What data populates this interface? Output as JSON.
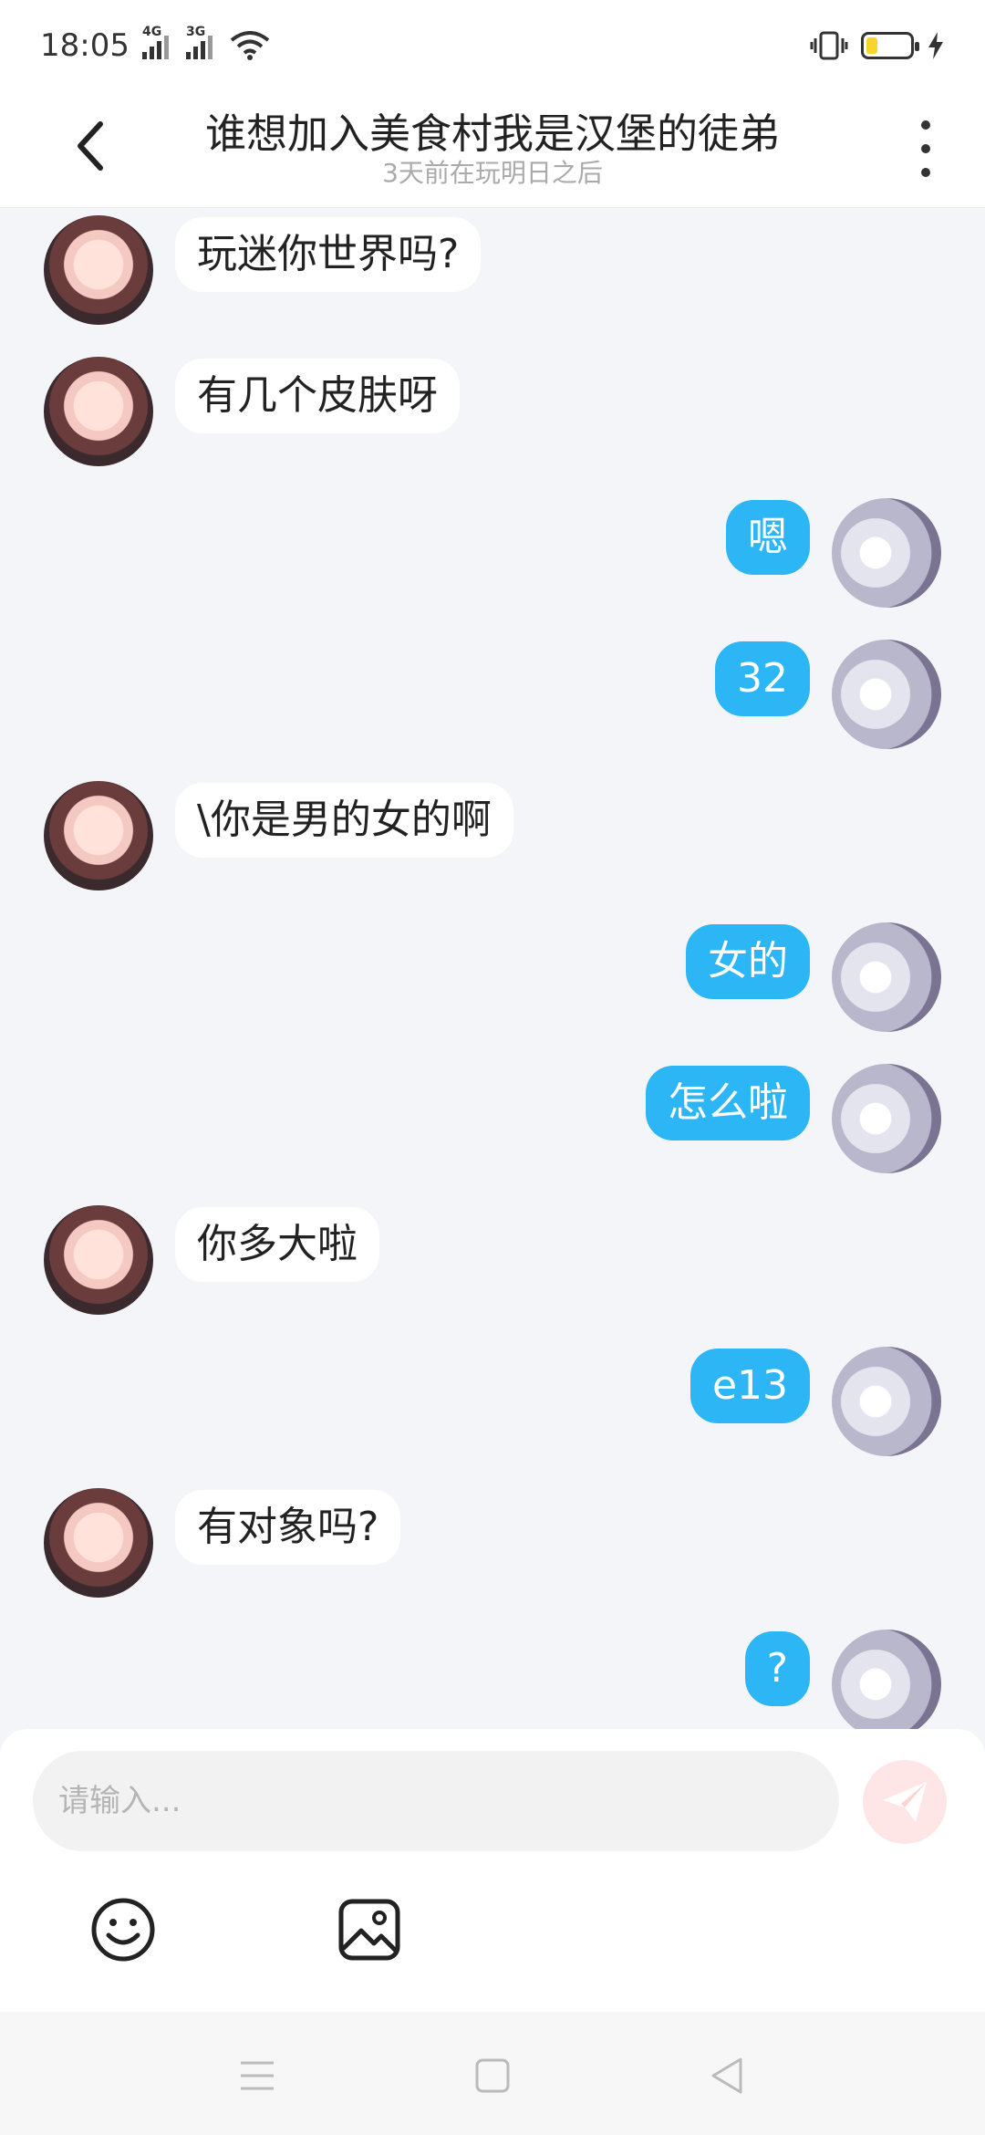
{
  "status_bar": {
    "time": "18:05",
    "network_1": "4G",
    "network_2": "3G",
    "battery_level": 0.15,
    "battery_color": "#f7d52a"
  },
  "header": {
    "title": "谁想加入美食村我是汉堡的徒弟",
    "subtitle": "3天前在玩明日之后"
  },
  "messages": [
    {
      "side": "left",
      "text": "玩迷你世界吗?"
    },
    {
      "side": "left",
      "text": "有几个皮肤呀"
    },
    {
      "side": "right",
      "text": "嗯"
    },
    {
      "side": "right",
      "text": "32"
    },
    {
      "side": "left",
      "text": "\\你是男的女的啊"
    },
    {
      "side": "right",
      "text": "女的"
    },
    {
      "side": "right",
      "text": "怎么啦"
    },
    {
      "side": "left",
      "text": "你多大啦"
    },
    {
      "side": "right",
      "text": "e13"
    },
    {
      "side": "left",
      "text": "有对象吗?"
    },
    {
      "side": "right",
      "text": "?"
    }
  ],
  "composer": {
    "placeholder": "请输入...",
    "value": ""
  },
  "colors": {
    "outgoing_bubble": "#2cb6f6",
    "incoming_bubble": "#ffffff",
    "send_button": "#ffe6e6",
    "background": "#f4f5f8"
  },
  "icons": {
    "back": "chevron-left-icon",
    "more": "more-vertical-icon",
    "send": "paper-plane-icon",
    "emoji": "smiley-icon",
    "image": "image-icon",
    "nav_menu": "menu-icon",
    "nav_home": "square-icon",
    "nav_back": "triangle-back-icon"
  }
}
